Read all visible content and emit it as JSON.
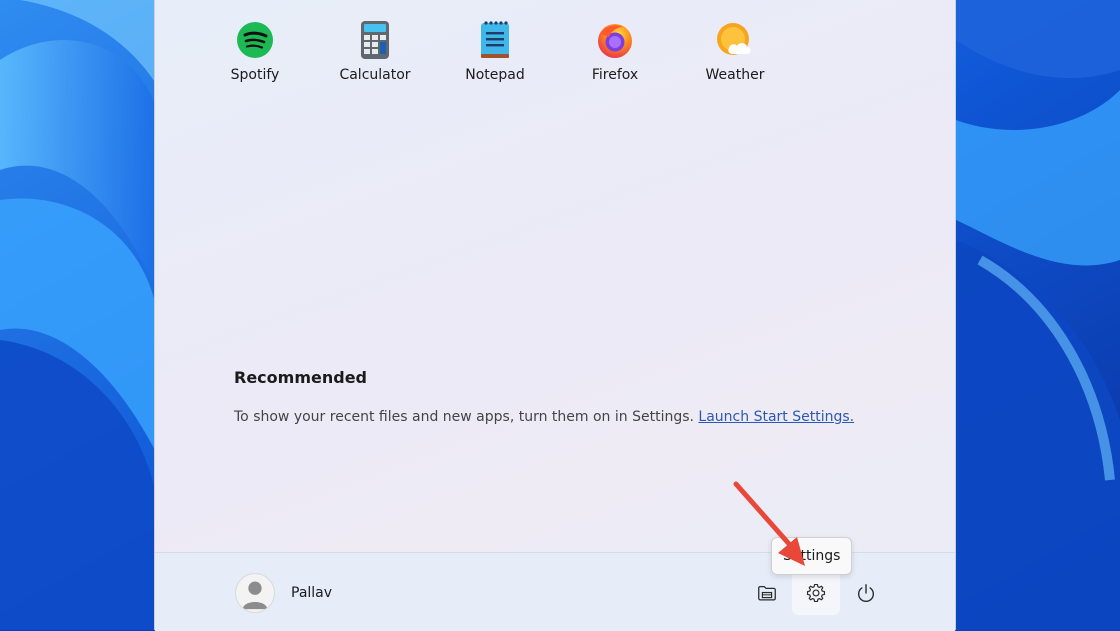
{
  "pinned_apps": [
    {
      "label": "Spotify",
      "icon": "spotify-icon"
    },
    {
      "label": "Calculator",
      "icon": "calculator-icon"
    },
    {
      "label": "Notepad",
      "icon": "notepad-icon"
    },
    {
      "label": "Firefox",
      "icon": "firefox-icon"
    },
    {
      "label": "Weather",
      "icon": "weather-icon"
    }
  ],
  "recommended": {
    "title": "Recommended",
    "message": "To show your recent files and new apps, turn them on in Settings.",
    "link_label": "Launch Start Settings."
  },
  "user": {
    "name": "Pallav"
  },
  "footer": {
    "tooltip": "Settings",
    "buttons": [
      "file-explorer-icon",
      "settings-gear-icon",
      "power-icon"
    ]
  },
  "colors": {
    "accent_link": "#2a59b5",
    "annotation_arrow": "#e8473a",
    "wallpaper": "#0a3fb8"
  }
}
